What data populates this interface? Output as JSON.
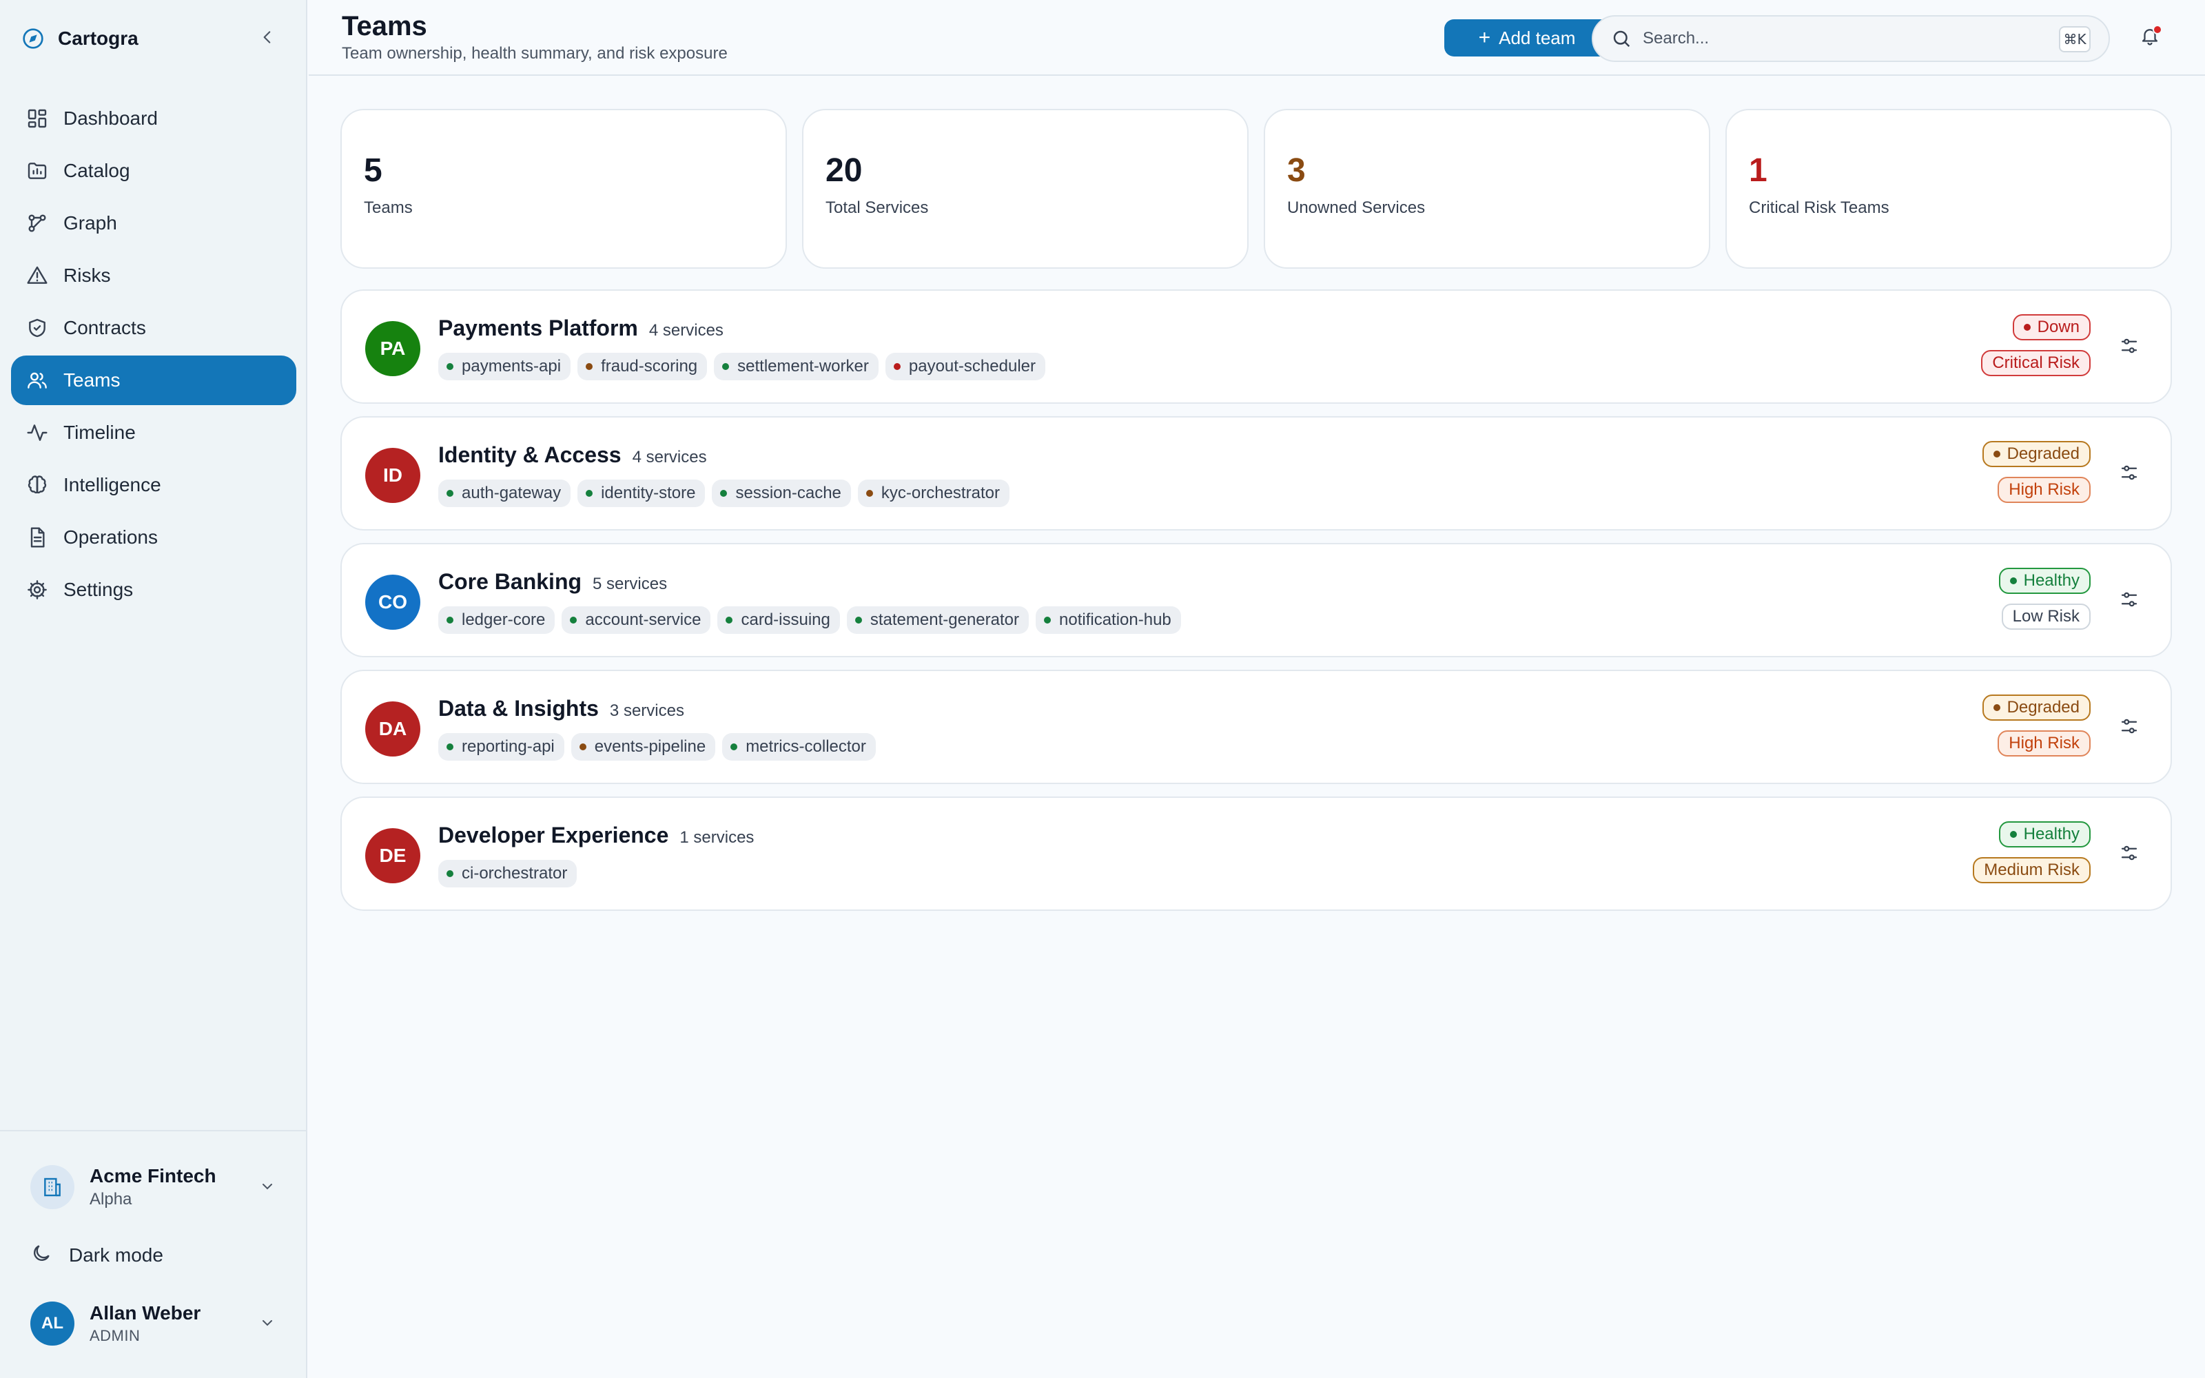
{
  "brand": {
    "name": "Cartogra"
  },
  "nav": {
    "items": [
      {
        "label": "Dashboard",
        "icon": "dashboard-icon",
        "active": false
      },
      {
        "label": "Catalog",
        "icon": "catalog-icon",
        "active": false
      },
      {
        "label": "Graph",
        "icon": "graph-icon",
        "active": false
      },
      {
        "label": "Risks",
        "icon": "warning-icon",
        "active": false
      },
      {
        "label": "Contracts",
        "icon": "shield-icon",
        "active": false
      },
      {
        "label": "Teams",
        "icon": "users-icon",
        "active": true
      },
      {
        "label": "Timeline",
        "icon": "activity-icon",
        "active": false
      },
      {
        "label": "Intelligence",
        "icon": "brain-icon",
        "active": false
      },
      {
        "label": "Operations",
        "icon": "document-icon",
        "active": false
      },
      {
        "label": "Settings",
        "icon": "gear-icon",
        "active": false
      }
    ]
  },
  "org": {
    "name": "Acme Fintech",
    "plan": "Alpha"
  },
  "dark_mode": {
    "label": "Dark mode"
  },
  "user": {
    "initials": "AL",
    "name": "Allan Weber",
    "role": "ADMIN"
  },
  "header": {
    "title": "Teams",
    "subtitle": "Team ownership, health summary, and risk exposure",
    "add_button": "Add team",
    "search_placeholder": "Search...",
    "search_shortcut": "⌘K"
  },
  "stats": [
    {
      "value": "5",
      "label": "Teams",
      "color": "#111827"
    },
    {
      "value": "20",
      "label": "Total Services",
      "color": "#111827"
    },
    {
      "value": "3",
      "label": "Unowned Services",
      "color": "#8a4b12"
    },
    {
      "value": "1",
      "label": "Critical Risk Teams",
      "color": "#b91c1c"
    }
  ],
  "colors": {
    "accent": "#1376b8",
    "healthy": "#15803d",
    "degraded": "#8a4b12",
    "down": "#b91c1c"
  },
  "teams": [
    {
      "initials": "PA",
      "avatar_color": "#16820f",
      "name": "Payments Platform",
      "count": "4 services",
      "services": [
        {
          "name": "payments-api",
          "status": "healthy"
        },
        {
          "name": "fraud-scoring",
          "status": "degraded"
        },
        {
          "name": "settlement-worker",
          "status": "healthy"
        },
        {
          "name": "payout-scheduler",
          "status": "down"
        }
      ],
      "health": {
        "label": "Down",
        "kind": "down"
      },
      "risk": {
        "label": "Critical Risk",
        "kind": "critical"
      }
    },
    {
      "initials": "ID",
      "avatar_color": "#b52222",
      "name": "Identity & Access",
      "count": "4 services",
      "services": [
        {
          "name": "auth-gateway",
          "status": "healthy"
        },
        {
          "name": "identity-store",
          "status": "healthy"
        },
        {
          "name": "session-cache",
          "status": "healthy"
        },
        {
          "name": "kyc-orchestrator",
          "status": "degraded"
        }
      ],
      "health": {
        "label": "Degraded",
        "kind": "degraded"
      },
      "risk": {
        "label": "High Risk",
        "kind": "high"
      }
    },
    {
      "initials": "CO",
      "avatar_color": "#1372c6",
      "name": "Core Banking",
      "count": "5 services",
      "services": [
        {
          "name": "ledger-core",
          "status": "healthy"
        },
        {
          "name": "account-service",
          "status": "healthy"
        },
        {
          "name": "card-issuing",
          "status": "healthy"
        },
        {
          "name": "statement-generator",
          "status": "healthy"
        },
        {
          "name": "notification-hub",
          "status": "healthy"
        }
      ],
      "health": {
        "label": "Healthy",
        "kind": "healthy"
      },
      "risk": {
        "label": "Low Risk",
        "kind": "low"
      }
    },
    {
      "initials": "DA",
      "avatar_color": "#b52222",
      "name": "Data & Insights",
      "count": "3 services",
      "services": [
        {
          "name": "reporting-api",
          "status": "healthy"
        },
        {
          "name": "events-pipeline",
          "status": "degraded"
        },
        {
          "name": "metrics-collector",
          "status": "healthy"
        }
      ],
      "health": {
        "label": "Degraded",
        "kind": "degraded"
      },
      "risk": {
        "label": "High Risk",
        "kind": "high"
      }
    },
    {
      "initials": "DE",
      "avatar_color": "#b52222",
      "name": "Developer Experience",
      "count": "1 services",
      "services": [
        {
          "name": "ci-orchestrator",
          "status": "healthy"
        }
      ],
      "health": {
        "label": "Healthy",
        "kind": "healthy"
      },
      "risk": {
        "label": "Medium Risk",
        "kind": "medium"
      }
    }
  ]
}
